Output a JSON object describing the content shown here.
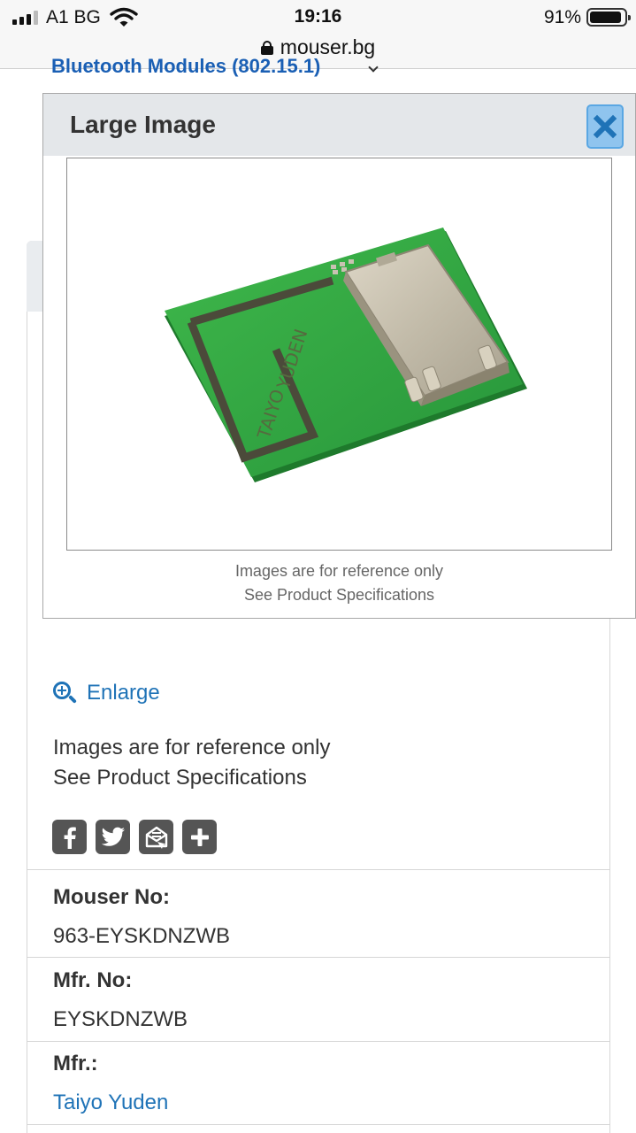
{
  "status_bar": {
    "carrier": "A1 BG",
    "time": "19:16",
    "battery_percent": "91%",
    "battery_level": 0.91
  },
  "browser": {
    "url": "mouser.bg"
  },
  "page": {
    "breadcrumb": "Bluetooth Modules (802.15.1)",
    "enlarge_label": "Enlarge",
    "reference_note_line1": "Images are for reference only",
    "reference_note_line2": "See Product Specifications",
    "share_icons": [
      "facebook-icon",
      "twitter-icon",
      "email-icon",
      "add-icon"
    ],
    "fields": {
      "mouser_no_label": "Mouser No:",
      "mouser_no_value": "963-EYSKDNZWB",
      "mfr_no_label": "Mfr. No:",
      "mfr_no_value": "EYSKDNZWB",
      "mfr_label": "Mfr.:",
      "mfr_value": "Taiyo Yuden"
    }
  },
  "modal": {
    "title": "Large Image",
    "close_icon": "close-icon",
    "product_marking_line1": "TAIYO",
    "product_marking_line2": "YUDEN",
    "note_line1": "Images are for reference only",
    "note_line2": "See Product Specifications"
  },
  "colors": {
    "link_blue": "#1f73b7",
    "modal_header": "#e4e7ea",
    "close_button": "#8fc4ee",
    "pcb_green": "#2fa83f",
    "shield_metal": "#c9c2b2"
  }
}
